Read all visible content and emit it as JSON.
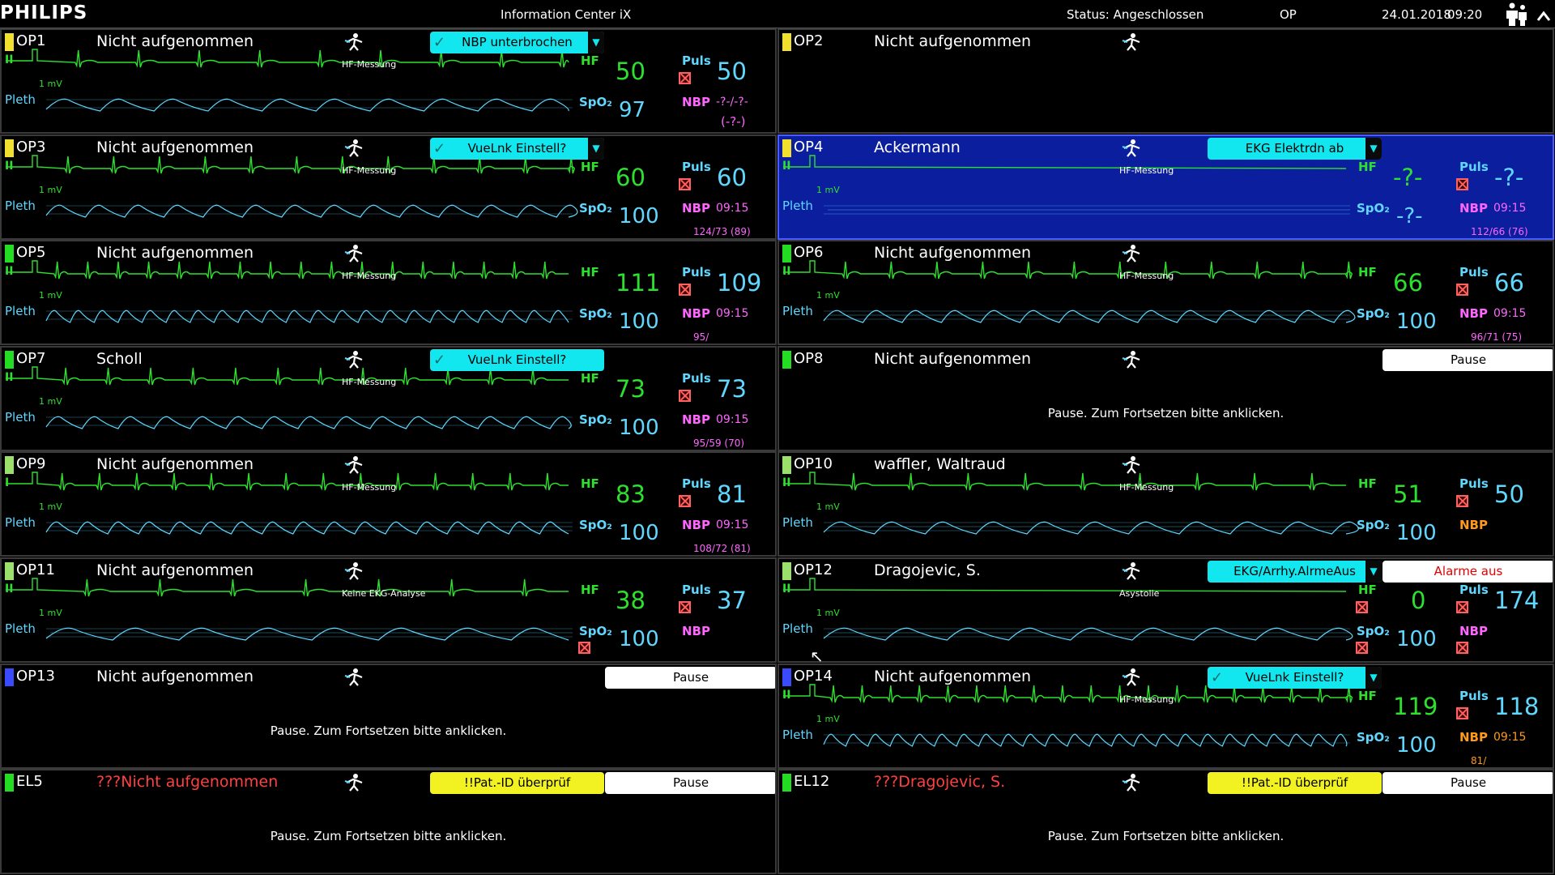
{
  "header": {
    "brand": "PHILIPS",
    "app_title": "Information Center iX",
    "status": "Status: Angeschlossen",
    "unit": "OP",
    "date": "24.01.2018",
    "time": "09:20"
  },
  "labels": {
    "hf": "HF",
    "spo2": "SpO₂",
    "puls": "Puls",
    "nbp": "NBP",
    "pleth": "Pleth",
    "mv": "1 mV",
    "pause_msg": "Pause. Zum Fortsetzen bitte anklicken."
  },
  "tiles": [
    {
      "bed": "OP1",
      "name": "Nicht aufgenommen",
      "msg": "HF-Messung",
      "lead": "II",
      "hf": "50",
      "spo2": "97",
      "puls": "50",
      "nbp_time": "-?-/-?-",
      "nbp_val": "(-?-)",
      "button": "NBP unterbrochen",
      "bed_color": "#f2e030"
    },
    {
      "bed": "OP2",
      "name": "Nicht aufgenommen",
      "bed_color": "#f2e030"
    },
    {
      "bed": "OP3",
      "name": "Nicht aufgenommen",
      "msg": "HF-Messung",
      "lead": "II",
      "hf": "60",
      "spo2": "100",
      "puls": "60",
      "nbp_time": "09:15",
      "nbp_val": "124/73 (89)",
      "button": "VueLnk Einstell?",
      "bed_color": "#f2e030"
    },
    {
      "bed": "OP4",
      "name": "Ackermann",
      "msg": "HF-Messung",
      "lead": "II",
      "hf": "-?-",
      "spo2": "-?-",
      "puls": "-?-",
      "nbp_time": "09:15",
      "nbp_val": "112/66 (76)",
      "button": "EKG   Elektrdn ab",
      "bed_color": "#f2e030"
    },
    {
      "bed": "OP5",
      "name": "Nicht aufgenommen",
      "msg": "HF-Messung",
      "lead": "II",
      "hf": "111",
      "spo2": "100",
      "puls": "109",
      "nbp_time": "09:15",
      "nbp_val": "95/",
      "bed_color": "#22dd22"
    },
    {
      "bed": "OP6",
      "name": "Nicht aufgenommen",
      "msg": "HF-Messung",
      "lead": "II",
      "hf": "66",
      "spo2": "100",
      "puls": "66",
      "nbp_time": "09:15",
      "nbp_val": "96/71 (75)",
      "bed_color": "#22dd22"
    },
    {
      "bed": "OP7",
      "name": "Scholl",
      "msg": "HF-Messung",
      "lead": "II",
      "hf": "73",
      "spo2": "100",
      "puls": "73",
      "nbp_time": "09:15",
      "nbp_val": "95/59 (70)",
      "button": "VueLnk Einstell?",
      "bed_color": "#22dd22"
    },
    {
      "bed": "OP8",
      "name": "Nicht aufgenommen",
      "pause": "Pause",
      "bed_color": "#22dd22"
    },
    {
      "bed": "OP9",
      "name": "Nicht aufgenommen",
      "msg": "HF-Messung",
      "lead": "I",
      "hf": "83",
      "spo2": "100",
      "puls": "81",
      "nbp_time": "09:15",
      "nbp_val": "108/72 (81)",
      "bed_color": "#9be06a"
    },
    {
      "bed": "OP10",
      "name": "waffler, Waltraud",
      "msg": "HF-Messung",
      "lead": "II",
      "hf": "51",
      "spo2": "100",
      "puls": "50",
      "nbp_time": "",
      "nbp_val": "",
      "bed_color": "#9be06a"
    },
    {
      "bed": "OP11",
      "name": "Nicht aufgenommen",
      "msg": "Keine EKG-Analyse",
      "lead": "II",
      "hf": "38",
      "spo2": "100",
      "puls": "37",
      "nbp_time": "",
      "nbp_val": "",
      "bed_color": "#9be06a"
    },
    {
      "bed": "OP12",
      "name": "Dragojevic, S.",
      "msg": "Asystolie",
      "lead": "II",
      "hf": "0",
      "spo2": "100",
      "puls": "174",
      "nbp_time": "",
      "nbp_val": "",
      "button": "EKG/Arrhy.AlrmeAus",
      "alarm": "Alarme aus",
      "bed_color": "#9be06a"
    },
    {
      "bed": "OP13",
      "name": "Nicht aufgenommen",
      "pause": "Pause",
      "bed_color": "#3a4aff"
    },
    {
      "bed": "OP14",
      "name": "Nicht aufgenommen",
      "msg": "HF-Messung",
      "lead": "II",
      "hf": "119",
      "spo2": "100",
      "puls": "118",
      "nbp_time": "09:15",
      "nbp_val": "81/",
      "button": "VueLnk Einstell?",
      "bed_color": "#3a4aff"
    },
    {
      "bed": "EL5",
      "name": "???Nicht aufgenommen",
      "warn": "!!Pat.-ID überprüf",
      "pause": "Pause",
      "bed_color": "#22dd22"
    },
    {
      "bed": "EL12",
      "name": "???Dragojevic, S.",
      "warn": "!!Pat.-ID überprüf",
      "pause": "Pause",
      "bed_color": "#22dd22"
    }
  ],
  "colors": {
    "ecg": "#2ee02e",
    "pleth": "#5fd7ff",
    "nbp": "#ff66ff",
    "nbp_alt": "#ff9a1a",
    "selected": "#0b1f9e",
    "alarm": "#ff4040"
  }
}
